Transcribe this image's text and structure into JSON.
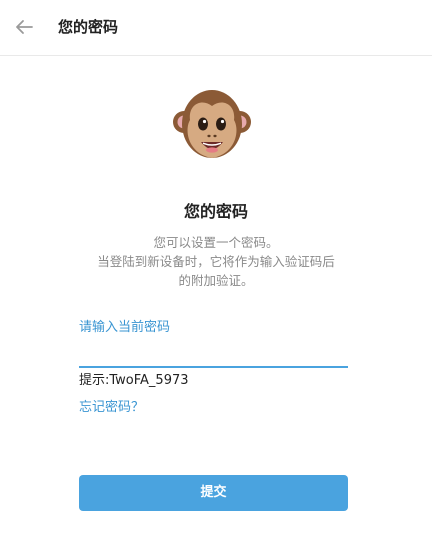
{
  "header": {
    "back_icon": "arrow-left-icon",
    "title": "您的密码"
  },
  "illustration": {
    "icon": "monkey-face-icon"
  },
  "main": {
    "title": "您的密码",
    "description_lines": [
      "您可以设置一个密码。",
      "当登陆到新设备时，它将作为输入验证码后",
      "的附加验证。"
    ]
  },
  "form": {
    "input_label": "请输入当前密码",
    "input_value": "",
    "hint": "提示:TwoFA_5973",
    "forgot_link": "忘记密码？",
    "submit_label": "提交"
  },
  "colors": {
    "accent": "#4aa3df",
    "link": "#3a95d2",
    "text_primary": "#222222",
    "text_secondary": "#8a8a8a",
    "divider": "#e9e9e9"
  }
}
